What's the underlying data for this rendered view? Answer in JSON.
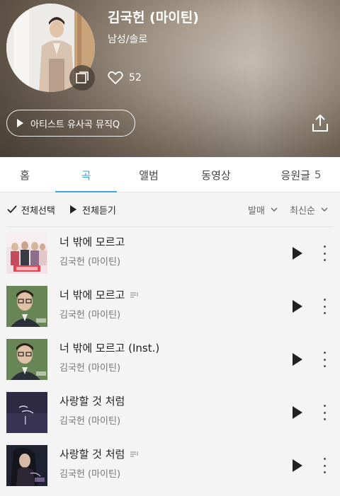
{
  "header": {
    "artist_name": "김국헌 (마이틴)",
    "genre": "남성/솔로",
    "like_count": "52",
    "mix_button_label": "아티스트 유사곡 뮤직Q"
  },
  "tabs": [
    {
      "label": "홈",
      "count": ""
    },
    {
      "label": "곡",
      "count": ""
    },
    {
      "label": "앨범",
      "count": ""
    },
    {
      "label": "동영상",
      "count": ""
    },
    {
      "label": "응원글",
      "count": "5"
    }
  ],
  "active_tab": "곡",
  "controls": {
    "select_all": "전체선택",
    "play_all": "전체듣기",
    "sort_type": "발매",
    "sort_order": "최신순"
  },
  "songs": [
    {
      "title": "너 밖에 모르고",
      "artist": "김국헌 (마이틴)",
      "has_lyrics_icon": false,
      "cover": "drama-cast"
    },
    {
      "title": "너 밖에 모르고",
      "artist": "김국헌 (마이틴)",
      "has_lyrics_icon": true,
      "cover": "man-glasses"
    },
    {
      "title": "너 밖에 모르고 (Inst.)",
      "artist": "김국헌 (마이틴)",
      "has_lyrics_icon": false,
      "cover": "man-glasses"
    },
    {
      "title": "사랑할 것 처럼",
      "artist": "김국헌 (마이틴)",
      "has_lyrics_icon": false,
      "cover": "purple-text"
    },
    {
      "title": "사랑할 것 처럼",
      "artist": "김국헌 (마이틴)",
      "has_lyrics_icon": true,
      "cover": "woman-dark"
    }
  ],
  "colors": {
    "accent": "#3b9fd5",
    "text": "#222222",
    "subtext": "#777777",
    "background": "#f4f4f4"
  },
  "icons": [
    "photo-icon",
    "heart-icon",
    "play-icon",
    "share-icon",
    "check-icon",
    "chevron-down-icon",
    "lyrics-icon",
    "more-icon"
  ]
}
